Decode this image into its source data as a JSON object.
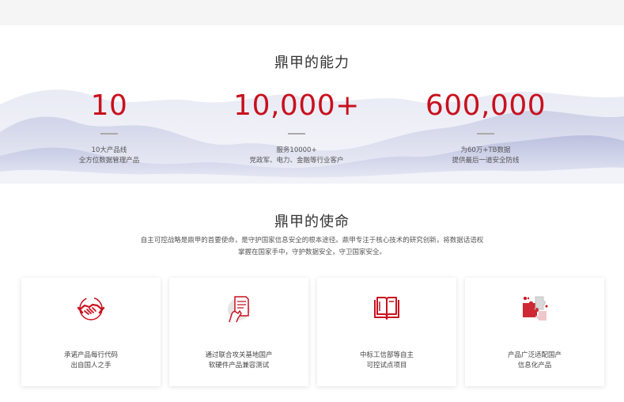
{
  "ability": {
    "title": "鼎甲的能力",
    "stats": [
      {
        "value": "10",
        "line1": "10大产品线",
        "line2": "全方位数据管理产品"
      },
      {
        "value": "10,000+",
        "line1": "服务10000+",
        "line2": "党政军、电力、金融等行业客户"
      },
      {
        "value": "600,000",
        "line1": "为60万+TB数据",
        "line2": "提供最后一道安全防线"
      }
    ]
  },
  "mission": {
    "title": "鼎甲的使命",
    "line1": "自主可控战略是鼎甲的首要使命，是守护国家信息安全的根本途径。鼎甲专注于核心技术的研究创新，将数据话语权",
    "line2": "掌握在国家手中，守护数据安全，守卫国家安全。"
  },
  "cards": [
    {
      "icon": "handshake-icon",
      "line1": "承诺产品每行代码",
      "line2": "出自国人之手"
    },
    {
      "icon": "document-hand-icon",
      "line1": "通过联合攻关基地国产",
      "line2": "软硬件产品兼容测试"
    },
    {
      "icon": "open-book-icon",
      "line1": "中标工信部等自主",
      "line2": "可控试点项目"
    },
    {
      "icon": "puzzle-icon",
      "line1": "产品广泛适配国产",
      "line2": "信息化产品"
    }
  ],
  "colors": {
    "accent": "#c8111d",
    "topbar": "#f5f5f5",
    "mountain": "#c9cde6"
  }
}
